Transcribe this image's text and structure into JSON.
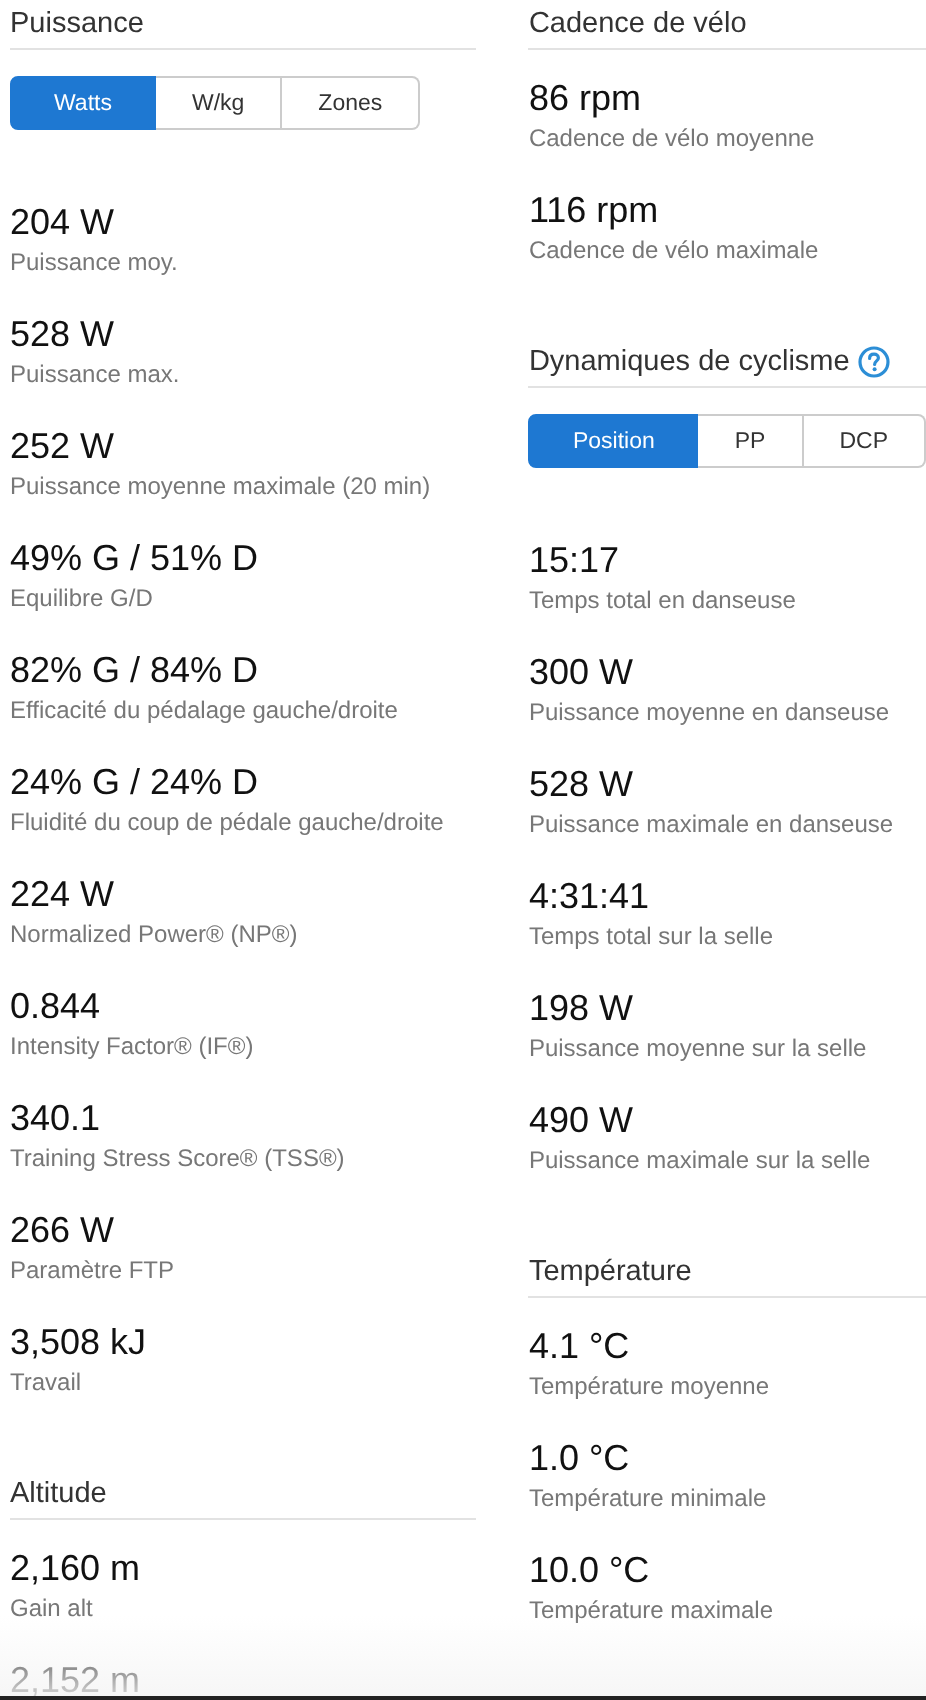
{
  "columns": [
    [
      {
        "title": "Puissance",
        "help": false,
        "tabs": [
          {
            "label": "Watts",
            "selected": true
          },
          {
            "label": "W/kg",
            "selected": false
          },
          {
            "label": "Zones",
            "selected": false
          }
        ],
        "stats": [
          {
            "value": "204 W",
            "label": "Puissance moy."
          },
          {
            "value": "528 W",
            "label": "Puissance max."
          },
          {
            "value": "252 W",
            "label": "Puissance moyenne maximale (20 min)"
          },
          {
            "value": "49% G / 51% D",
            "label": "Equilibre G/D"
          },
          {
            "value": "82% G / 84% D",
            "label": "Efficacité du pédalage gauche/droite"
          },
          {
            "value": "24% G / 24% D",
            "label": "Fluidité du coup de pédale gauche/droite"
          },
          {
            "value": "224 W",
            "label": "Normalized Power® (NP®)"
          },
          {
            "value": "0.844",
            "label": "Intensity Factor® (IF®)"
          },
          {
            "value": "340.1",
            "label": "Training Stress Score® (TSS®)"
          },
          {
            "value": "266 W",
            "label": "Paramètre FTP"
          },
          {
            "value": "3,508 kJ",
            "label": "Travail"
          }
        ]
      },
      {
        "title": "Altitude",
        "help": false,
        "stats": [
          {
            "value": "2,160 m",
            "label": "Gain alt"
          },
          {
            "value": "2,152 m"
          }
        ]
      }
    ],
    [
      {
        "title": "Cadence de vélo",
        "help": false,
        "stats": [
          {
            "value": "86 rpm",
            "label": "Cadence de vélo moyenne"
          },
          {
            "value": "116 rpm",
            "label": "Cadence de vélo maximale"
          }
        ]
      },
      {
        "title": "Dynamiques de cyclisme",
        "help": true,
        "tabs": [
          {
            "label": "Position",
            "selected": true
          },
          {
            "label": "PP",
            "selected": false
          },
          {
            "label": "DCP",
            "selected": false
          }
        ],
        "stats": [
          {
            "value": "15:17",
            "label": "Temps total en danseuse"
          },
          {
            "value": "300 W",
            "label": "Puissance moyenne en danseuse"
          },
          {
            "value": "528 W",
            "label": "Puissance maximale en danseuse"
          },
          {
            "value": "4:31:41",
            "label": "Temps total sur la selle"
          },
          {
            "value": "198 W",
            "label": "Puissance moyenne sur la selle"
          },
          {
            "value": "490 W",
            "label": "Puissance maximale sur la selle"
          }
        ]
      },
      {
        "title": "Température",
        "help": false,
        "stats": [
          {
            "value": "4.1 °C",
            "label": "Température moyenne"
          },
          {
            "value": "1.0 °C",
            "label": "Température minimale"
          },
          {
            "value": "10.0 °C",
            "label": "Température maximale"
          }
        ]
      }
    ]
  ]
}
